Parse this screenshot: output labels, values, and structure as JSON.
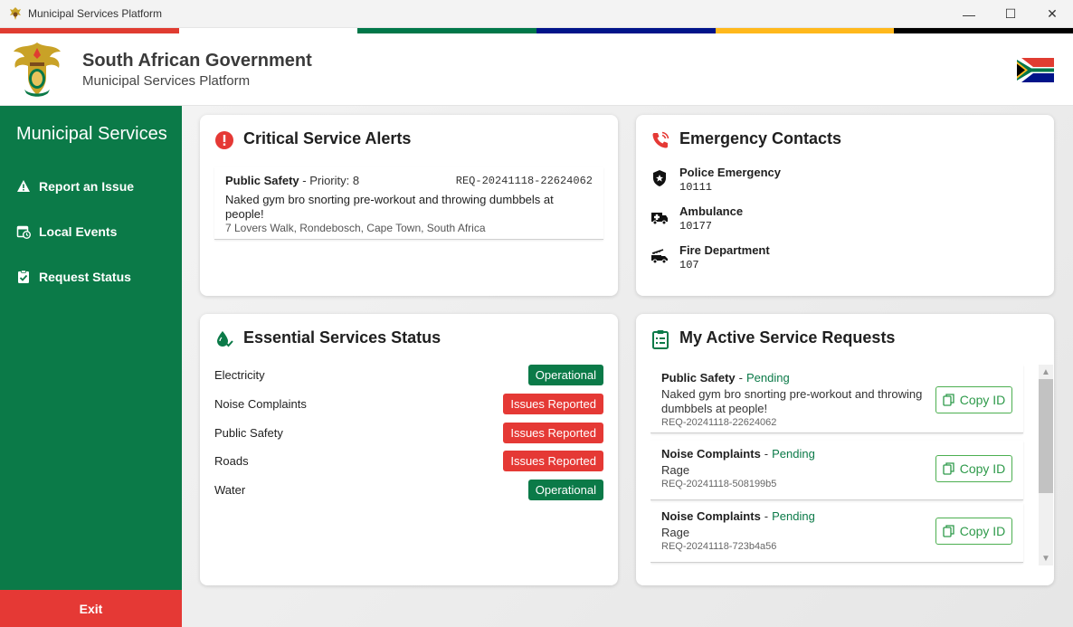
{
  "window": {
    "title": "Municipal Services Platform",
    "minimize": "—",
    "maximize": "☐",
    "close": "✕"
  },
  "header": {
    "title": "South African Government",
    "subtitle": "Municipal Services Platform"
  },
  "colors": {
    "green": "#0b7a48",
    "red": "#e53935",
    "stripe": [
      "#e03c31",
      "#ffffff",
      "#007749",
      "#001489",
      "#ffb81c",
      "#000000"
    ]
  },
  "sidebar": {
    "title": "Municipal Services",
    "items": [
      {
        "label": "Report an Issue",
        "icon": "warning-icon"
      },
      {
        "label": "Local Events",
        "icon": "calendar-clock-icon"
      },
      {
        "label": "Request Status",
        "icon": "clipboard-check-icon"
      }
    ],
    "exit_label": "Exit"
  },
  "alerts": {
    "title": "Critical Service Alerts",
    "items": [
      {
        "category": "Public Safety",
        "priority": " - Priority: 8",
        "id": "REQ-20241118-22624062",
        "description": "Naked gym bro snorting pre-workout and throwing dumbbels at people!",
        "address": "7 Lovers Walk, Rondebosch, Cape Town, South Africa"
      }
    ]
  },
  "emergency": {
    "title": "Emergency Contacts",
    "contacts": [
      {
        "name": "Police Emergency",
        "number": "10111",
        "icon": "police-badge-icon"
      },
      {
        "name": "Ambulance",
        "number": "10177",
        "icon": "ambulance-icon"
      },
      {
        "name": "Fire Department",
        "number": "107",
        "icon": "fire-truck-icon"
      }
    ]
  },
  "services": {
    "title": "Essential Services Status",
    "items": [
      {
        "name": "Electricity",
        "status": "Operational",
        "ok": true
      },
      {
        "name": "Noise Complaints",
        "status": "Issues Reported",
        "ok": false
      },
      {
        "name": "Public Safety",
        "status": "Issues Reported",
        "ok": false
      },
      {
        "name": "Roads",
        "status": "Issues Reported",
        "ok": false
      },
      {
        "name": "Water",
        "status": "Operational",
        "ok": true
      }
    ]
  },
  "requests": {
    "title": "My Active Service Requests",
    "copy_label": "Copy ID",
    "separator": "-",
    "items": [
      {
        "category": "Public Safety",
        "status": "Pending",
        "description": "Naked gym bro snorting pre-workout and throwing dumbbels at people!",
        "id": "REQ-20241118-22624062"
      },
      {
        "category": "Noise Complaints",
        "status": "Pending",
        "description": "Rage",
        "id": "REQ-20241118-508199b5"
      },
      {
        "category": "Noise Complaints",
        "status": "Pending",
        "description": "Rage",
        "id": "REQ-20241118-723b4a56"
      }
    ]
  }
}
